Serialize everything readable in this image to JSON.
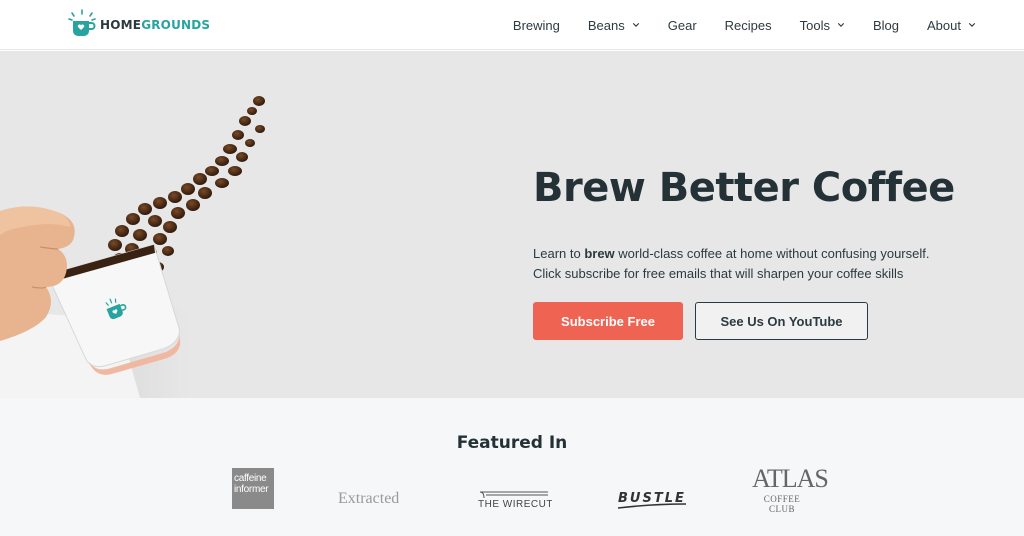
{
  "brand": {
    "name_part1": "HOME",
    "name_part2": "GROUNDS",
    "accent_color": "#27a3a0",
    "dark_color": "#243238"
  },
  "nav": {
    "items": [
      {
        "label": "Brewing",
        "has_dropdown": false
      },
      {
        "label": "Beans",
        "has_dropdown": true
      },
      {
        "label": "Gear",
        "has_dropdown": false
      },
      {
        "label": "Recipes",
        "has_dropdown": false
      },
      {
        "label": "Tools",
        "has_dropdown": true
      },
      {
        "label": "Blog",
        "has_dropdown": false
      },
      {
        "label": "About",
        "has_dropdown": true
      }
    ]
  },
  "hero": {
    "title": "Brew Better Coffee",
    "text_line1_pre": "Learn to ",
    "text_line1_bold": "brew",
    "text_line1_post": " world-class coffee at home without confusing yourself.",
    "text_line2": "Click subscribe for free emails that will sharpen your coffee skills",
    "primary_button": "Subscribe Free",
    "secondary_button": "See Us On YouTube",
    "primary_color": "#ef6352",
    "background_color": "#e7e7e7"
  },
  "featured": {
    "title": "Featured In",
    "logos": {
      "caffeine_line1": "caffeine",
      "caffeine_line2": "informer",
      "extracted": "Extracted",
      "wirecutter": "THE WIRECUTTER",
      "bustle": "BUSTLE",
      "atlas_line1": "ATLAS",
      "atlas_line2": "COFFEE CLUB"
    }
  }
}
